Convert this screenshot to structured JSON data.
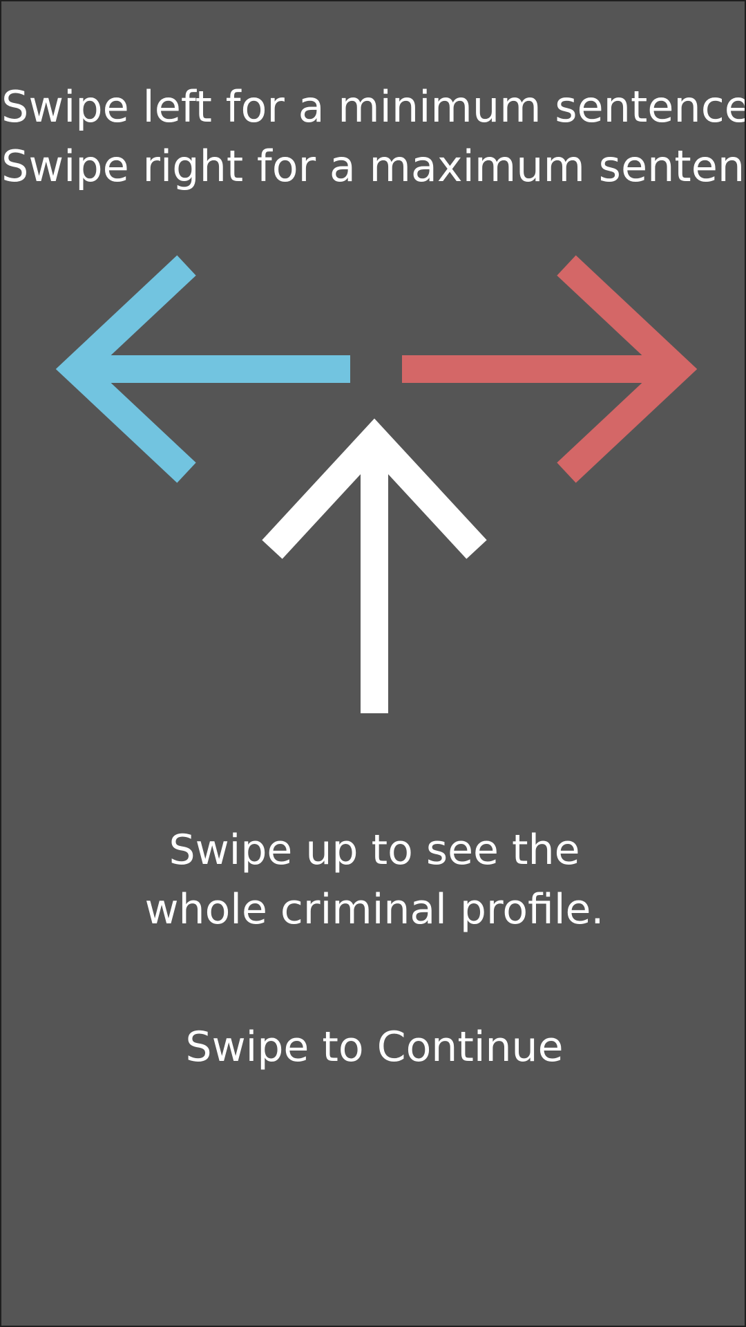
{
  "tutorial": {
    "line_left": "Swipe left for a minimum sentence",
    "line_right": "Swipe right for a maximum sentence",
    "line_up_1": "Swipe up to see the",
    "line_up_2": "whole criminal profile.",
    "continue_label": "Swipe to Continue"
  },
  "icons": {
    "left": "arrow-left-icon",
    "right": "arrow-right-icon",
    "up": "arrow-up-icon"
  },
  "colors": {
    "background": "#555555",
    "left_arrow": "#72c4e0",
    "right_arrow": "#d46767",
    "up_arrow": "#ffffff",
    "text": "#ffffff"
  }
}
